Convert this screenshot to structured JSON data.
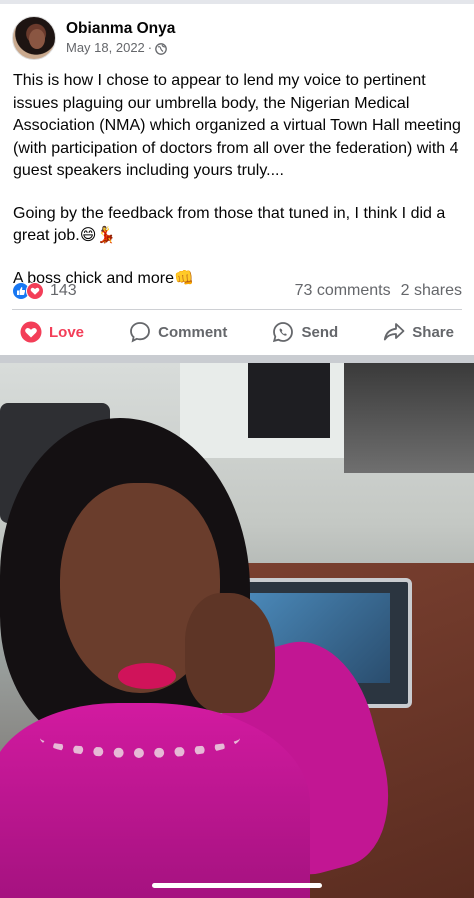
{
  "post": {
    "author": "Obianma Onya",
    "date": "May 18, 2022",
    "date_separator": "·",
    "privacy_icon": "globe-icon",
    "text": {
      "p1": "This is how I chose to appear to lend my voice to pertinent issues plaguing our umbrella body, the Nigerian Medical Association (NMA) which organized a virtual Town Hall meeting (with participation of doctors from all over the federation) with 4 guest speakers including yours truly....",
      "p2": "Going by the feedback from those that tuned in, I think I did a great job.😄💃",
      "p3": "A boss chick and more👊"
    }
  },
  "engagement": {
    "reaction_icons": [
      "like-icon",
      "love-icon"
    ],
    "reaction_count": "143",
    "comments": "73 comments",
    "shares": "2 shares"
  },
  "actions": {
    "love": "Love",
    "comment": "Comment",
    "send": "Send",
    "share": "Share"
  },
  "colors": {
    "love_red": "#f33e58",
    "like_blue": "#1877f2",
    "meta_gray": "#65676b"
  }
}
